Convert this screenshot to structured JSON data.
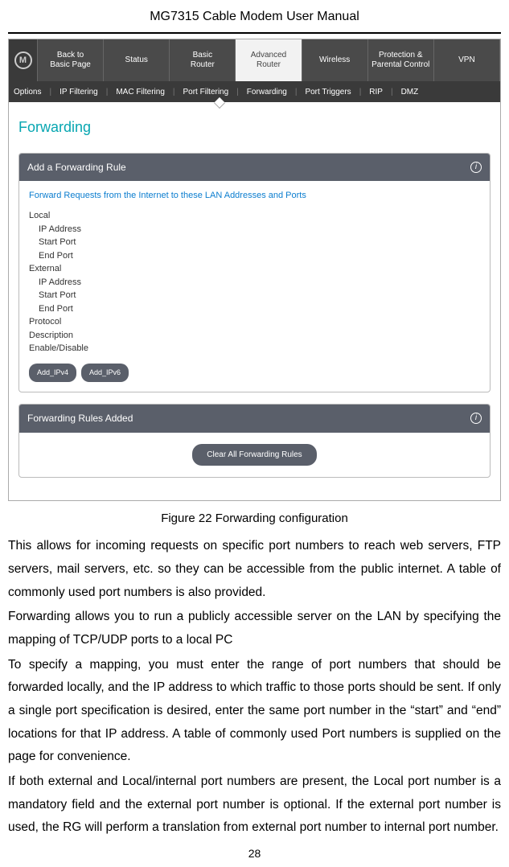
{
  "header": {
    "title": "MG7315 Cable Modem User Manual"
  },
  "screenshot": {
    "logo_letter": "M",
    "top_nav": [
      "Back to\nBasic Page",
      "Status",
      "Basic\nRouter",
      "Advanced\nRouter",
      "Wireless",
      "Protection &\nParental Control",
      "VPN"
    ],
    "top_nav_active_index": 3,
    "sub_nav": [
      "Options",
      "IP Filtering",
      "MAC Filtering",
      "Port Filtering",
      "Forwarding",
      "Port Triggers",
      "RIP",
      "DMZ"
    ],
    "section_title": "Forwarding",
    "panel_add": {
      "title": "Add a Forwarding Rule",
      "link": "Forward Requests from the Internet to these LAN Addresses and Ports",
      "groups": [
        {
          "label": "Local",
          "fields": [
            "IP Address",
            "Start Port",
            "End Port"
          ]
        },
        {
          "label": "External",
          "fields": [
            "IP Address",
            "Start Port",
            "End Port"
          ]
        }
      ],
      "flat_fields": [
        "Protocol",
        "Description",
        "Enable/Disable"
      ],
      "buttons": [
        "Add_IPv4",
        "Add_IPv6"
      ]
    },
    "panel_added": {
      "title": "Forwarding Rules Added",
      "button": "Clear All Forwarding Rules"
    }
  },
  "caption": "Figure 22 Forwarding configuration",
  "paragraphs": [
    "This allows for incoming requests on specific port numbers to reach web servers, FTP servers, mail servers, etc. so they can be accessible from the public internet. A table of commonly used port numbers is also provided.",
    "Forwarding allows you to run a publicly accessible server on the LAN by specifying the mapping of TCP/UDP ports to a local PC",
    "To specify a mapping, you must enter the range of port numbers that should be forwarded locally, and the IP address to which traffic to those ports should be sent. If only a single port specification is desired, enter the same port number in the “start” and “end” locations for that IP address.   A table of commonly used Port numbers is supplied on the page for convenience.",
    "If both external and Local/internal port numbers are present, the Local port number is a mandatory field and the external port number is optional.  If the external port number is used, the RG will perform a translation from external port number to internal port number."
  ],
  "page_number": "28"
}
